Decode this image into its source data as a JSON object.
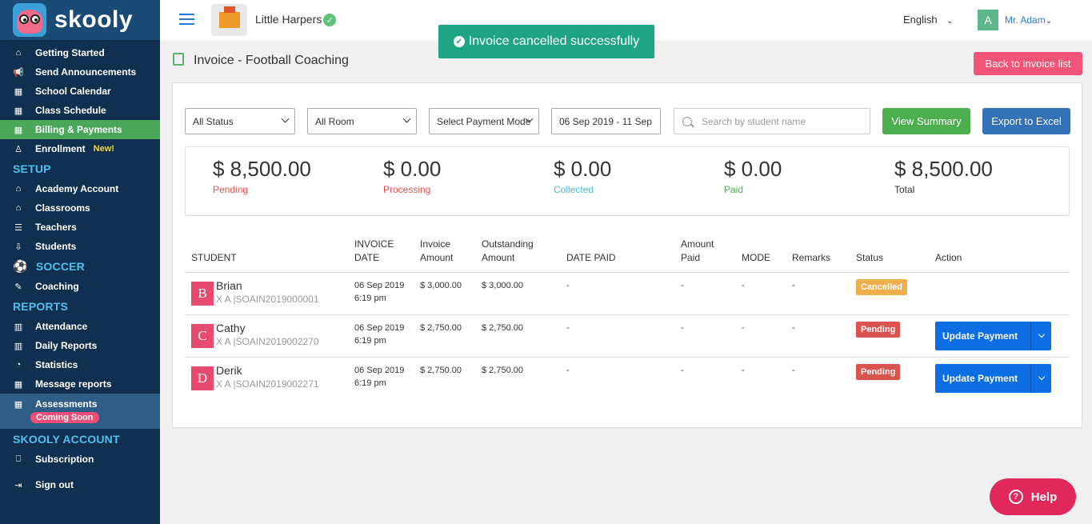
{
  "sidebar": {
    "logo": "skooly",
    "items_main": [
      {
        "label": "Getting Started",
        "icon": "home-icon",
        "glyph": "⌂"
      },
      {
        "label": "Send Announcements",
        "icon": "megaphone-icon",
        "glyph": "📢"
      },
      {
        "label": "School Calendar",
        "icon": "calendar-icon",
        "glyph": "▦"
      },
      {
        "label": "Class Schedule",
        "icon": "calendar-icon",
        "glyph": "▦"
      },
      {
        "label": "Billing & Payments",
        "icon": "calendar-icon",
        "glyph": "▦"
      },
      {
        "label": "Enrollment",
        "icon": "user-icon",
        "glyph": "♙",
        "badge": "New!"
      }
    ],
    "setup_title": "SETUP",
    "items_setup": [
      {
        "label": "Academy Account",
        "icon": "bank-icon",
        "glyph": "⌂"
      },
      {
        "label": "Classrooms",
        "icon": "classroom-icon",
        "glyph": "⌂"
      },
      {
        "label": "Teachers",
        "icon": "teacher-icon",
        "glyph": "☰"
      },
      {
        "label": "Students",
        "icon": "student-icon",
        "glyph": "⇩"
      }
    ],
    "soccer_title": "SOCCER",
    "items_soccer": [
      {
        "label": "Coaching",
        "icon": "edit-icon",
        "glyph": "✎"
      }
    ],
    "reports_title": "REPORTS",
    "items_reports": [
      {
        "label": "Attendance",
        "icon": "gift-icon",
        "glyph": "▥"
      },
      {
        "label": "Daily Reports",
        "icon": "gift-icon",
        "glyph": "▥"
      },
      {
        "label": "Statistics",
        "icon": "pie-chart-icon",
        "glyph": "◔"
      },
      {
        "label": "Message reports",
        "icon": "calendar-icon",
        "glyph": "▦"
      }
    ],
    "assessments": {
      "label": "Assessments",
      "badge": "Coming Soon"
    },
    "account_title": "SKOOLY ACCOUNT",
    "subscription": "Subscription",
    "signout": "Sign out"
  },
  "topbar": {
    "school_name": "Little Harpers",
    "language": "English",
    "user_initial": "A",
    "user_name": "Mr. Adam"
  },
  "toast": "Invoice cancelled successfully",
  "page": {
    "title": "Invoice - Football Coaching",
    "back_button": "Back to invoice list"
  },
  "filters": {
    "status": "All Status",
    "room": "All Room",
    "payment_mode": "Select Payment Mode",
    "date_range": "06 Sep 2019 - 11 Sep",
    "search_placeholder": "Search by student name",
    "view_summary": "View Summary",
    "export": "Export to Excel"
  },
  "summary": [
    {
      "amount": "$ 8,500.00",
      "label": "Pending",
      "color": "#e05050"
    },
    {
      "amount": "$ 0.00",
      "label": "Processing",
      "color": "#e05050"
    },
    {
      "amount": "$ 0.00",
      "label": "Collected",
      "color": "#4fb8d8"
    },
    {
      "amount": "$ 0.00",
      "label": "Paid",
      "color": "#4cae4f"
    },
    {
      "amount": "$ 8,500.00",
      "label": "Total",
      "color": "#333333"
    }
  ],
  "table": {
    "headers": {
      "student": "STUDENT",
      "invoice_date_1": "INVOICE",
      "invoice_date_2": "DATE",
      "invoice_amount_1": "Invoice",
      "invoice_amount_2": "Amount",
      "outstanding_1": "Outstanding",
      "outstanding_2": "Amount",
      "date_paid": "DATE PAID",
      "amount_paid_1": "Amount",
      "amount_paid_2": "Paid",
      "mode": "MODE",
      "remarks": "Remarks",
      "status": "Status",
      "action": "Action"
    },
    "rows": [
      {
        "initial": "B",
        "name": "Brian",
        "sub": "X A |SOAIN2019000001",
        "date": "06 Sep 2019",
        "time": "6:19 pm",
        "invoice": "$ 3,000.00",
        "outstanding": "$ 3,000.00",
        "date_paid": "-",
        "amount_paid": "-",
        "mode": "-",
        "remarks": "-",
        "status": "Cancelled",
        "action": ""
      },
      {
        "initial": "C",
        "name": "Cathy",
        "sub": "X A |SOAIN2019002270",
        "date": "06 Sep 2019",
        "time": "6:19 pm",
        "invoice": "$ 2,750.00",
        "outstanding": "$ 2,750.00",
        "date_paid": "-",
        "amount_paid": "-",
        "mode": "-",
        "remarks": "-",
        "status": "Pending",
        "action": "Update Payment"
      },
      {
        "initial": "D",
        "name": "Derik",
        "sub": "X A |SOAIN2019002271",
        "date": "06 Sep 2019",
        "time": "6:19 pm",
        "invoice": "$ 2,750.00",
        "outstanding": "$ 2,750.00",
        "date_paid": "-",
        "amount_paid": "-",
        "mode": "-",
        "remarks": "-",
        "status": "Pending",
        "action": "Update Payment"
      }
    ]
  },
  "help": "Help"
}
